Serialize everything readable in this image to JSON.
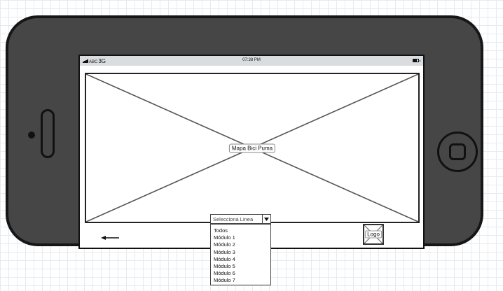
{
  "status_bar": {
    "carrier": "ABC",
    "network": "3G",
    "time": "07:38 PM",
    "battery_level": 0.7
  },
  "map": {
    "label": "Mapa Bici Puma"
  },
  "controls": {
    "back_icon": "arrow-left-icon",
    "logo_label": "Logo"
  },
  "line_select": {
    "selected": "Selecciona Linea",
    "arrow_icon": "chevron-down-icon",
    "options": [
      "Todos",
      "Módulo 1",
      "Módulo 2",
      "Módulo 3",
      "Módulo 4",
      "Módulo 5",
      "Módulo 6",
      "Módulo 7"
    ]
  }
}
